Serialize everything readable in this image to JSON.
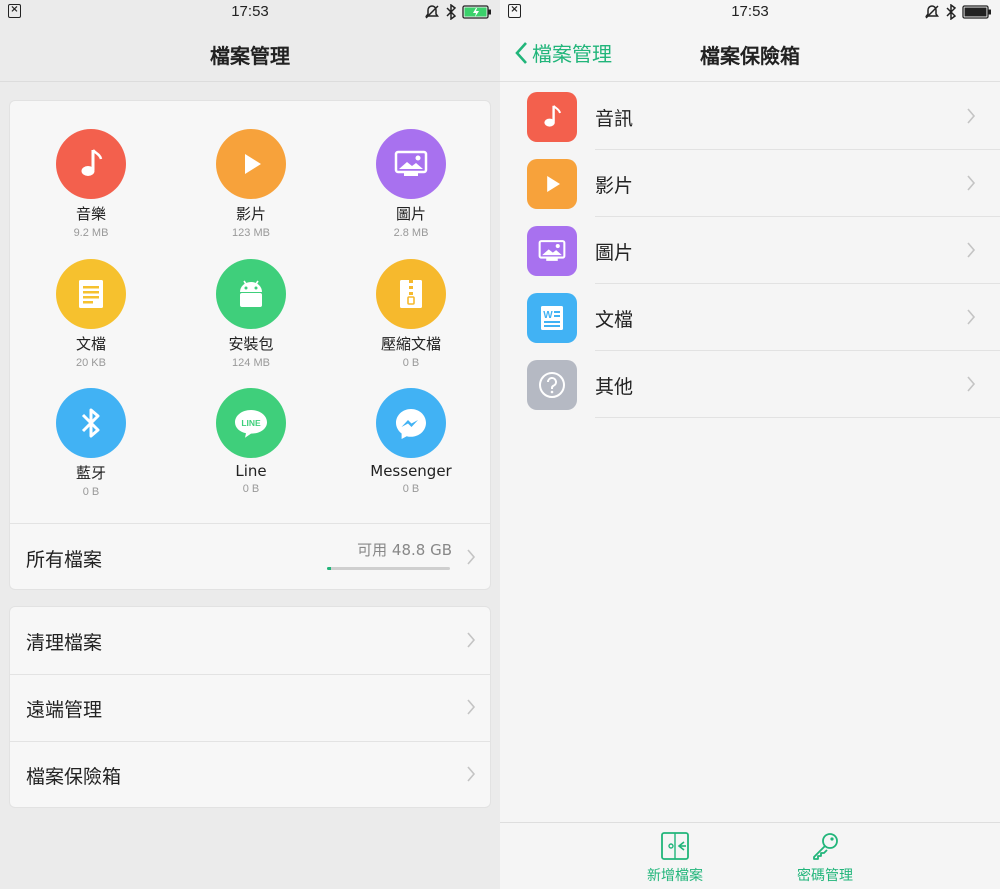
{
  "status": {
    "time": "17:53"
  },
  "left": {
    "title": "檔案管理",
    "categories": [
      {
        "label": "音樂",
        "size": "9.2 MB",
        "icon": "music-note-icon",
        "color": "#f3604d"
      },
      {
        "label": "影片",
        "size": "123 MB",
        "icon": "play-icon",
        "color": "#f7a23b"
      },
      {
        "label": "圖片",
        "size": "2.8 MB",
        "icon": "picture-icon",
        "color": "#a871ef"
      },
      {
        "label": "文檔",
        "size": "20 KB",
        "icon": "document-icon",
        "color": "#f6c12e"
      },
      {
        "label": "安裝包",
        "size": "124 MB",
        "icon": "android-icon",
        "color": "#3fcf7b"
      },
      {
        "label": "壓縮文檔",
        "size": "0 B",
        "icon": "zip-icon",
        "color": "#f6b92d"
      },
      {
        "label": "藍牙",
        "size": "0 B",
        "icon": "bluetooth-icon",
        "color": "#41b2f4"
      },
      {
        "label": "Line",
        "size": "0 B",
        "icon": "line-icon",
        "color": "#3fcf7b"
      },
      {
        "label": "Messenger",
        "size": "0 B",
        "icon": "messenger-icon",
        "color": "#41b2f4"
      }
    ],
    "all_files": {
      "label": "所有檔案",
      "available": "可用 48.8 GB",
      "used_fraction": 0.03
    },
    "tools": [
      {
        "label": "清理檔案"
      },
      {
        "label": "遠端管理"
      },
      {
        "label": "檔案保險箱"
      }
    ]
  },
  "right": {
    "back_label": "檔案管理",
    "title": "檔案保險箱",
    "items": [
      {
        "label": "音訊",
        "icon": "music-note-icon",
        "color": "#f3604d"
      },
      {
        "label": "影片",
        "icon": "play-icon",
        "color": "#f7a23b"
      },
      {
        "label": "圖片",
        "icon": "picture-icon",
        "color": "#a871ef"
      },
      {
        "label": "文檔",
        "icon": "word-document-icon",
        "color": "#41b2f4"
      },
      {
        "label": "其他",
        "icon": "question-icon",
        "color": "#b5b9c3"
      }
    ],
    "bottom": {
      "add_label": "新增檔案",
      "password_label": "密碼管理"
    }
  },
  "colors": {
    "accent": "#21b57a"
  }
}
